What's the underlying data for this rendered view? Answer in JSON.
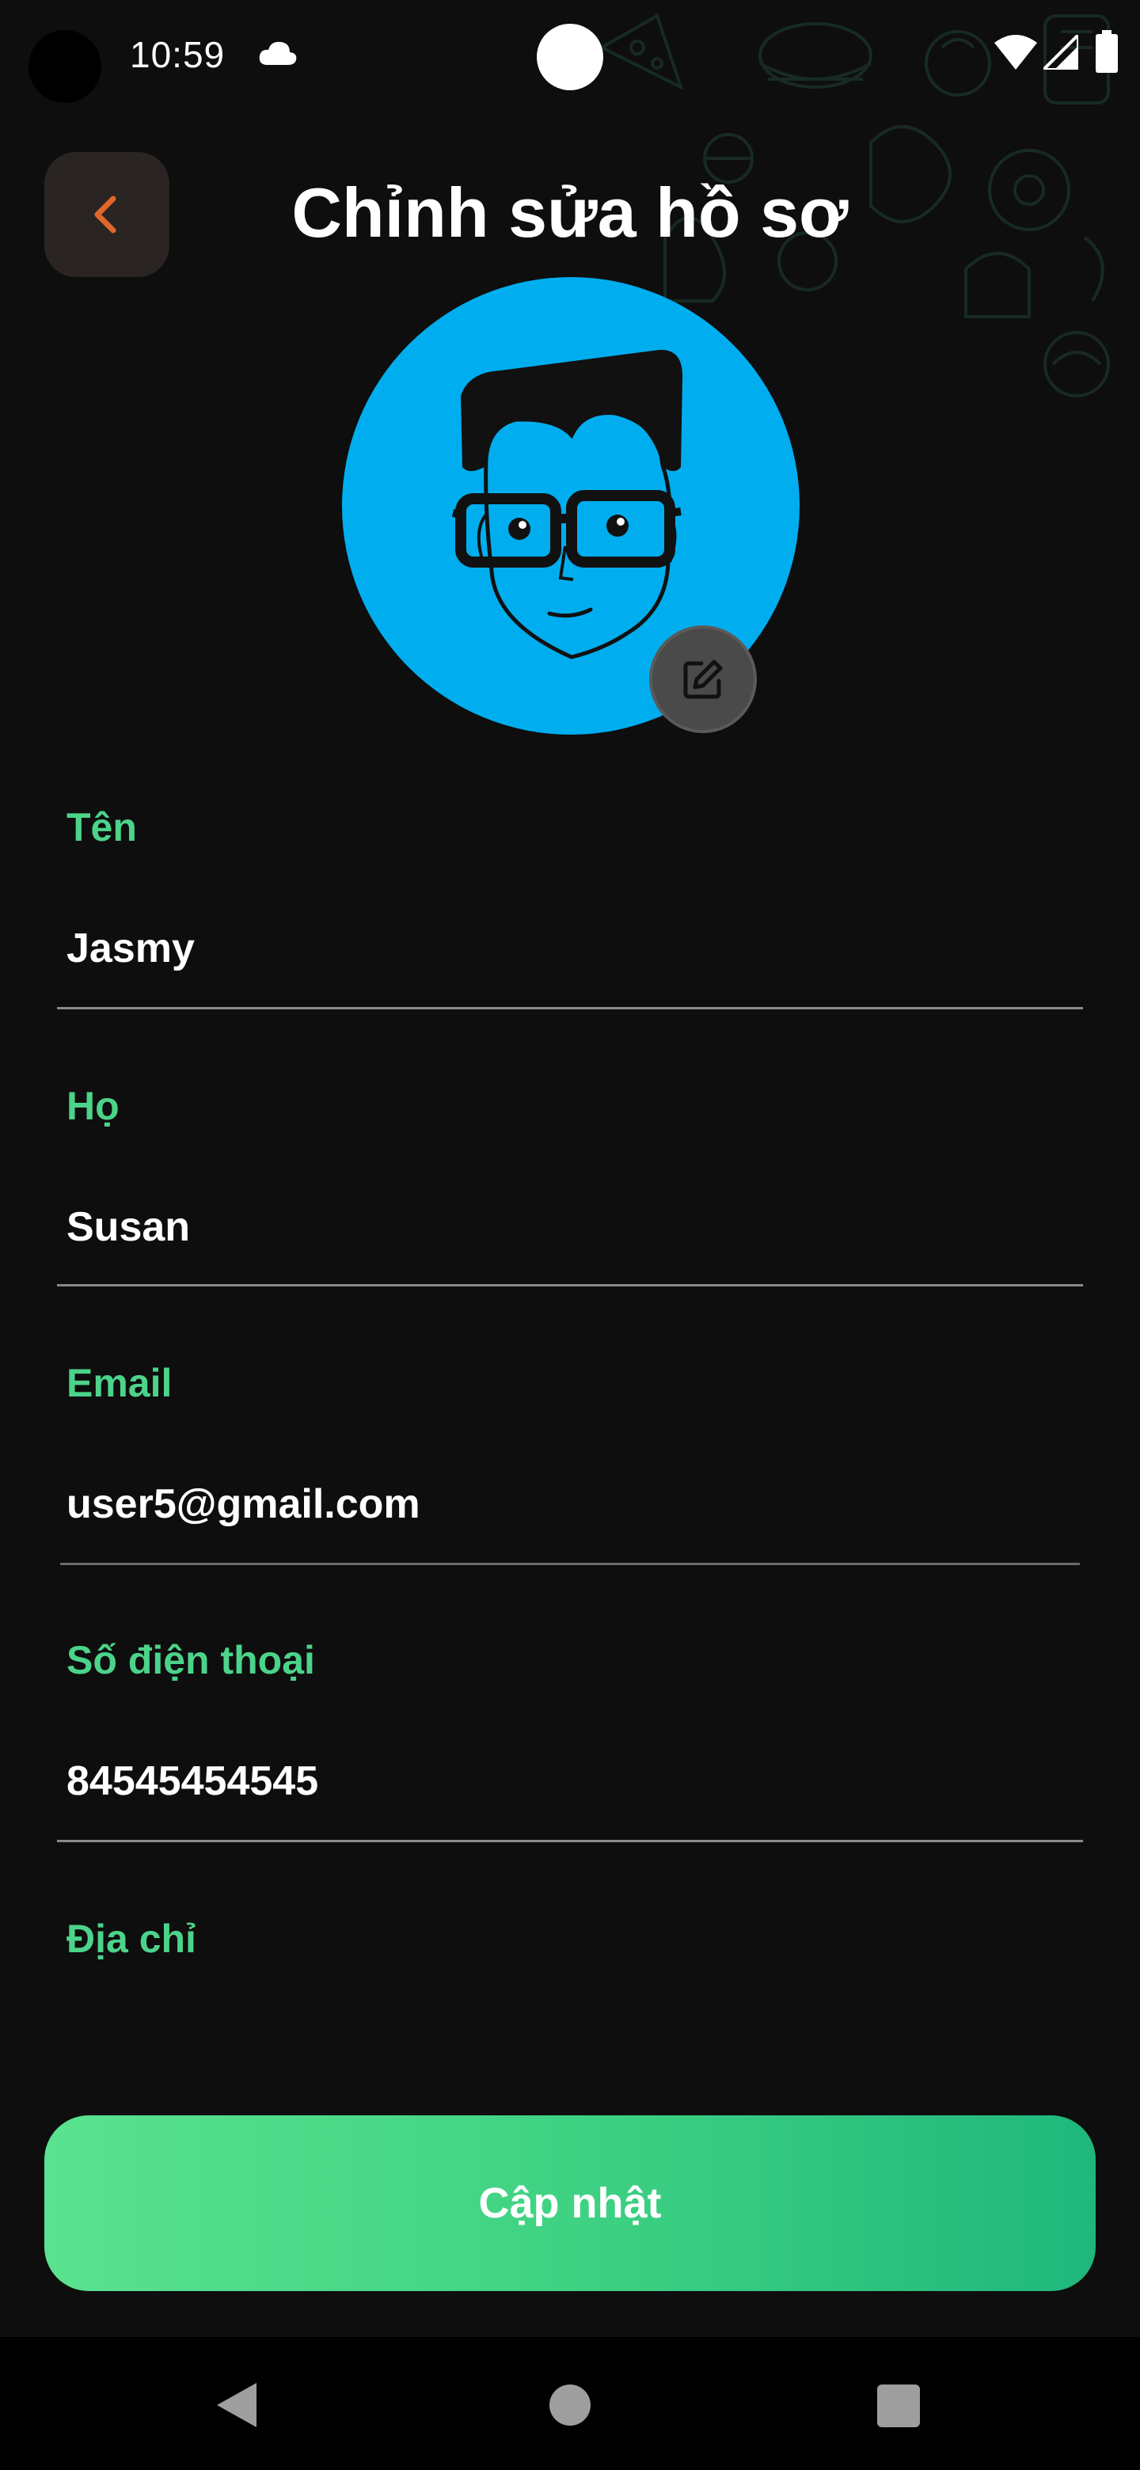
{
  "status_bar": {
    "time": "10:59",
    "icons": [
      "cloud-icon",
      "wifi-icon",
      "signal-icon",
      "battery-icon"
    ]
  },
  "header": {
    "title": "Chỉnh sửa hồ sơ",
    "back_icon": "chevron-left-icon"
  },
  "avatar": {
    "edit_icon": "edit-pencil-icon"
  },
  "form": {
    "first_name": {
      "label": "Tên",
      "value": "Jasmy"
    },
    "last_name": {
      "label": "Họ",
      "value": "Susan"
    },
    "email": {
      "label": "Email",
      "value": "user5@gmail.com"
    },
    "phone": {
      "label": "Số điện thoại",
      "value": "84545454545"
    },
    "address": {
      "label": "Địa chỉ",
      "value": ""
    }
  },
  "actions": {
    "update_label": "Cập nhật"
  },
  "colors": {
    "background": "#0e0e0e",
    "accent": "#4cd38a",
    "back_icon": "#e0672a",
    "avatar_bg": "#00aeef"
  },
  "nav_bar": {
    "icons": [
      "nav-back-icon",
      "nav-home-icon",
      "nav-recents-icon"
    ]
  }
}
